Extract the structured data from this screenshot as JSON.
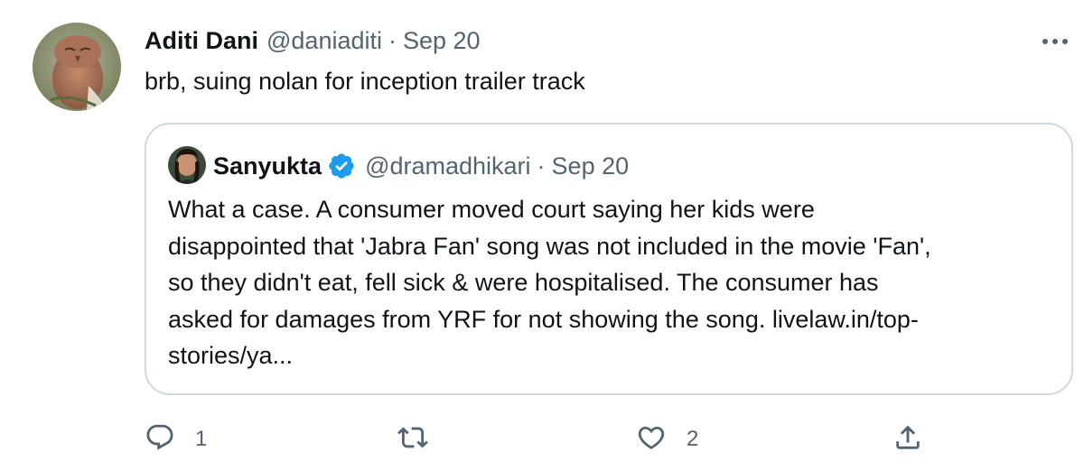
{
  "tweet": {
    "author_name": "Aditi Dani",
    "author_handle": "@daniaditi",
    "separator": "·",
    "date": "Sep 20",
    "text": "brb, suing nolan for inception trailer track"
  },
  "quoted_tweet": {
    "author_name": "Sanyukta",
    "author_handle": "@dramadhikari",
    "separator": "·",
    "date": "Sep 20",
    "text_lines": [
      "What a case. A consumer moved court saying her kids were",
      "disappointed that 'Jabra Fan' song was not included in the movie 'Fan',",
      "so they didn't eat, fell sick & were hospitalised. The consumer has",
      "asked for damages from YRF for not showing the song.  livelaw.in/top-",
      "stories/ya..."
    ]
  },
  "actions": {
    "reply_count": "1",
    "retweet_count": "",
    "like_count": "2"
  },
  "icons": {
    "more": "more-horizontal-icon",
    "verified": "verified-badge-icon",
    "reply": "reply-icon",
    "retweet": "retweet-icon",
    "like": "heart-icon",
    "share": "share-icon"
  },
  "colors": {
    "text": "#0f1419",
    "secondary": "#536471",
    "border": "#cfd9de",
    "verified": "#1d9bf0"
  }
}
